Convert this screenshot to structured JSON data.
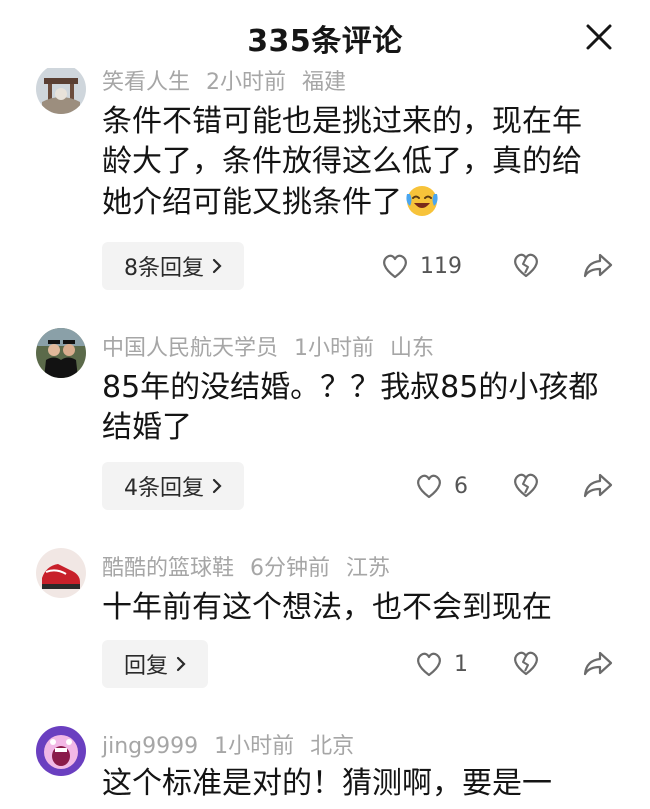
{
  "header": {
    "title": "335条评论",
    "close_icon": "close-icon"
  },
  "comments": [
    {
      "username": "笑看人生",
      "time": "2小时前",
      "location": "福建",
      "text": "条件不错可能也是挑过来的，现在年龄大了，条件放得这么低了，真的给她介绍可能又挑条件了",
      "emoji": "laughing-crying-emoji",
      "reply_label": "8条回复",
      "likes": "119"
    },
    {
      "username": "中国人民航天学员",
      "time": "1小时前",
      "location": "山东",
      "text": "85年的没结婚。？？我叔85的小孩都结婚了",
      "reply_label": "4条回复",
      "likes": "6"
    },
    {
      "username": "酷酷的篮球鞋",
      "time": "6分钟前",
      "location": "江苏",
      "text": "十年前有这个想法，也不会到现在",
      "reply_label": "回复",
      "likes": "1"
    },
    {
      "username": "jing9999",
      "time": "1小时前",
      "location": "北京",
      "text": "这个标准是对的！猜测啊，要是一"
    }
  ],
  "colors": {
    "meta": "#a6a6a6",
    "pill_bg": "#f3f3f3",
    "icon": "#6b6b6b"
  }
}
